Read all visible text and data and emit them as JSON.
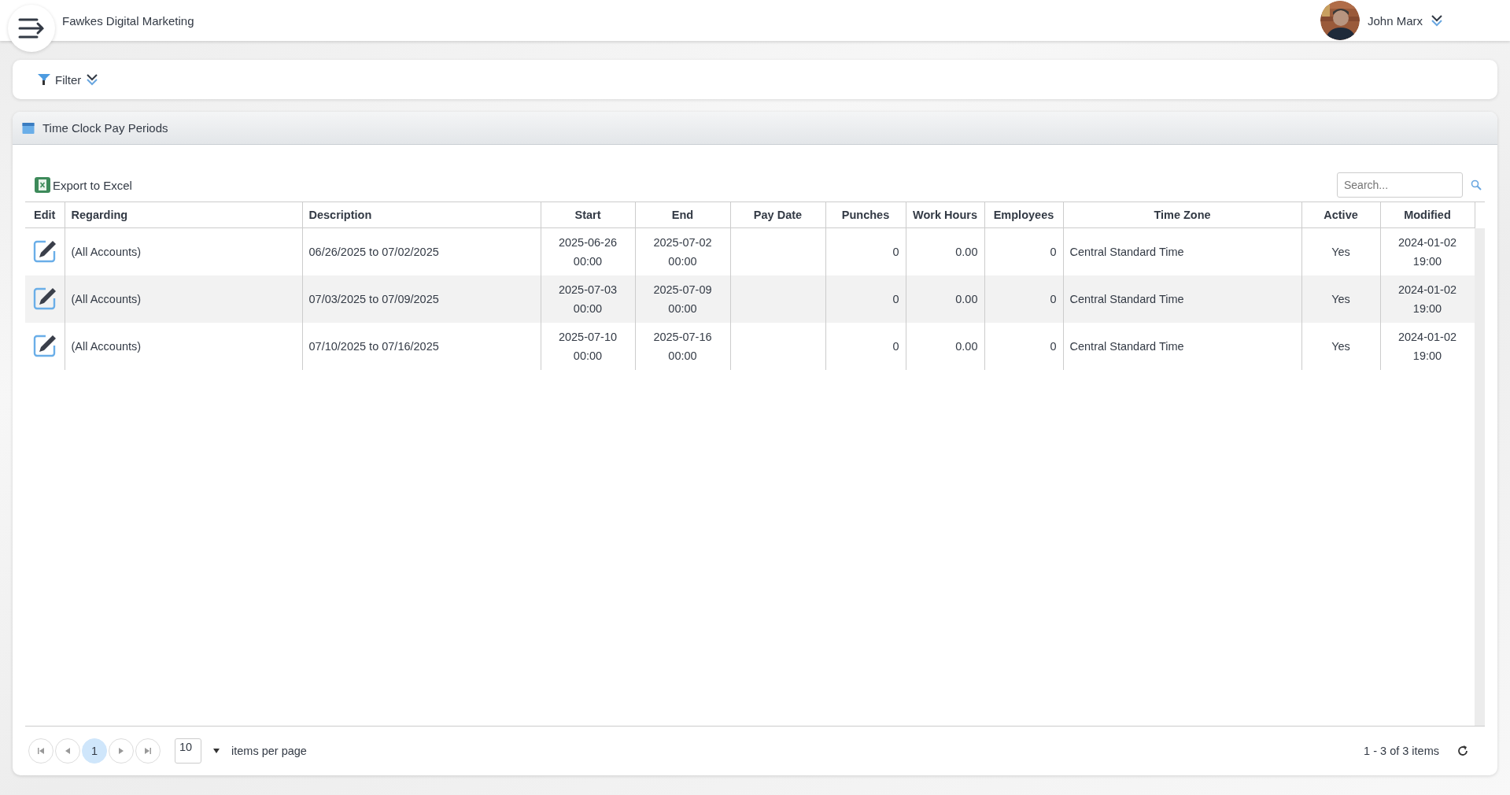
{
  "header": {
    "company": "Fawkes Digital Marketing",
    "user": {
      "name": "John Marx"
    }
  },
  "filter": {
    "label": "Filter"
  },
  "panel": {
    "title": "Time Clock Pay Periods",
    "toolbar": {
      "export_label": "Export to Excel",
      "search": {
        "placeholder": "Search..."
      }
    },
    "table": {
      "columns": [
        "Edit",
        "Regarding",
        "Description",
        "Start",
        "End",
        "Pay Date",
        "Punches",
        "Work Hours",
        "Employees",
        "Time Zone",
        "Active",
        "Modified"
      ],
      "rows": [
        {
          "cells": [
            "",
            "(All Accounts)",
            "06/26/2025 to 07/02/2025",
            [
              "2025-06-26",
              "00:00"
            ],
            [
              "2025-07-02",
              "00:00"
            ],
            "",
            "0",
            "0.00",
            "0",
            "Central Standard Time",
            "Yes",
            [
              "2024-01-02",
              "19:00"
            ]
          ]
        },
        {
          "cells": [
            "",
            "(All Accounts)",
            "07/03/2025 to 07/09/2025",
            [
              "2025-07-03",
              "00:00"
            ],
            [
              "2025-07-09",
              "00:00"
            ],
            "",
            "0",
            "0.00",
            "0",
            "Central Standard Time",
            "Yes",
            [
              "2024-01-02",
              "19:00"
            ]
          ]
        },
        {
          "cells": [
            "",
            "(All Accounts)",
            "07/10/2025 to 07/16/2025",
            [
              "2025-07-10",
              "00:00"
            ],
            [
              "2025-07-16",
              "00:00"
            ],
            "",
            "0",
            "0.00",
            "0",
            "Central Standard Time",
            "Yes",
            [
              "2024-01-02",
              "19:00"
            ]
          ]
        }
      ]
    },
    "pager": {
      "pages": [
        {
          "label": "1",
          "selected": true
        }
      ],
      "page_size": "10",
      "page_size_label": "items per page",
      "summary": "1 - 3 of 3 items"
    }
  }
}
